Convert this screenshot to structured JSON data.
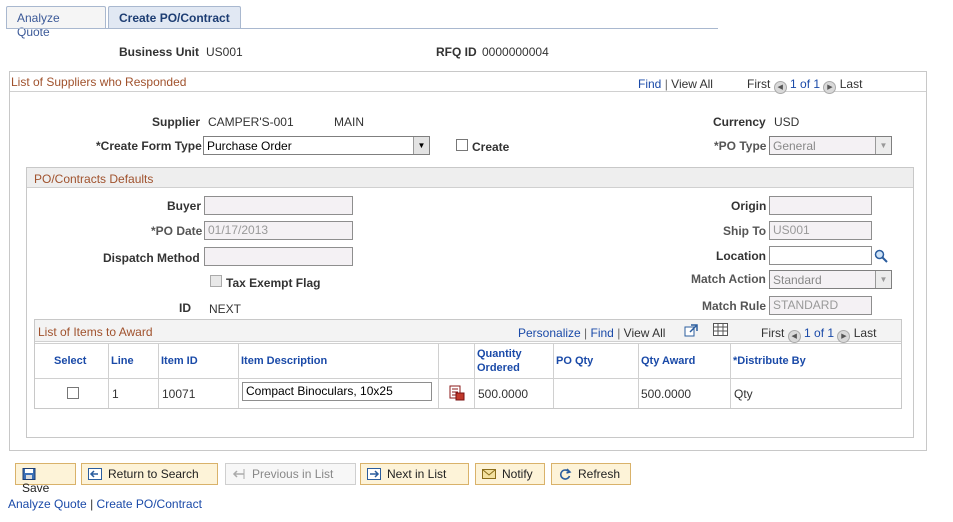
{
  "tabs": [
    {
      "label": "Analyze Quote",
      "active": false
    },
    {
      "label": "Create PO/Contract",
      "active": true
    }
  ],
  "header": {
    "business_unit_label": "Business Unit",
    "business_unit_value": "US001",
    "rfq_label": "RFQ ID",
    "rfq_value": "0000000004"
  },
  "suppliers": {
    "title": "List of Suppliers who Responded",
    "nav": {
      "find": "Find",
      "sep": "|",
      "view_all": "View All",
      "first": "First",
      "count": "1 of 1",
      "last": "Last"
    },
    "supplier_label": "Supplier",
    "supplier_value": "CAMPER'S-001",
    "supplier_location": "MAIN",
    "currency_label": "Currency",
    "currency_value": "USD",
    "create_form_type_label": "*Create Form Type",
    "create_form_type_value": "Purchase Order",
    "create_label": "Create",
    "po_type_label": "*PO Type",
    "po_type_value": "General"
  },
  "defaults": {
    "title": "PO/Contracts Defaults",
    "buyer_label": "Buyer",
    "buyer_value": "",
    "origin_label": "Origin",
    "origin_value": "",
    "po_date_label": "*PO Date",
    "po_date_value": "01/17/2013",
    "ship_to_label": "Ship To",
    "ship_to_value": "US001",
    "dispatch_label": "Dispatch Method",
    "dispatch_value": "",
    "location_label": "Location",
    "location_value": "",
    "tax_exempt_label": "Tax Exempt Flag",
    "match_action_label": "Match Action",
    "match_action_value": "Standard",
    "id_label": "ID",
    "id_value": "NEXT",
    "match_rule_label": "Match Rule",
    "match_rule_value": "STANDARD"
  },
  "items": {
    "title": "List of Items to Award",
    "nav": {
      "personalize": "Personalize",
      "sep": "|",
      "find": "Find",
      "view_all": "View All",
      "first": "First",
      "count": "1 of 1",
      "last": "Last"
    },
    "columns": {
      "select": "Select",
      "line": "Line",
      "item_id": "Item ID",
      "item_description": "Item Description",
      "quantity_ordered_1": "Quantity",
      "quantity_ordered_2": "Ordered",
      "po_qty": "PO Qty",
      "qty_award": "Qty Award",
      "distribute_by": "*Distribute By"
    },
    "rows": [
      {
        "line": "1",
        "item_id": "10071",
        "item_description": "Compact Binoculars, 10x25",
        "quantity_ordered": "500.0000",
        "po_qty": "",
        "qty_award": "500.0000",
        "distribute_by": "Qty"
      }
    ]
  },
  "buttons": {
    "save": "Save",
    "return_to_search": "Return to Search",
    "previous_in_list": "Previous in List",
    "next_in_list": "Next in List",
    "notify": "Notify",
    "refresh": "Refresh"
  },
  "footer_links": {
    "analyze_quote": "Analyze Quote",
    "sep": "|",
    "create_po_contract": "Create PO/Contract"
  },
  "colors": {
    "section_title": "#a0522d",
    "link": "#1a4aa8",
    "button_bg": "#fdf3d8",
    "button_border": "#d9b26a"
  }
}
